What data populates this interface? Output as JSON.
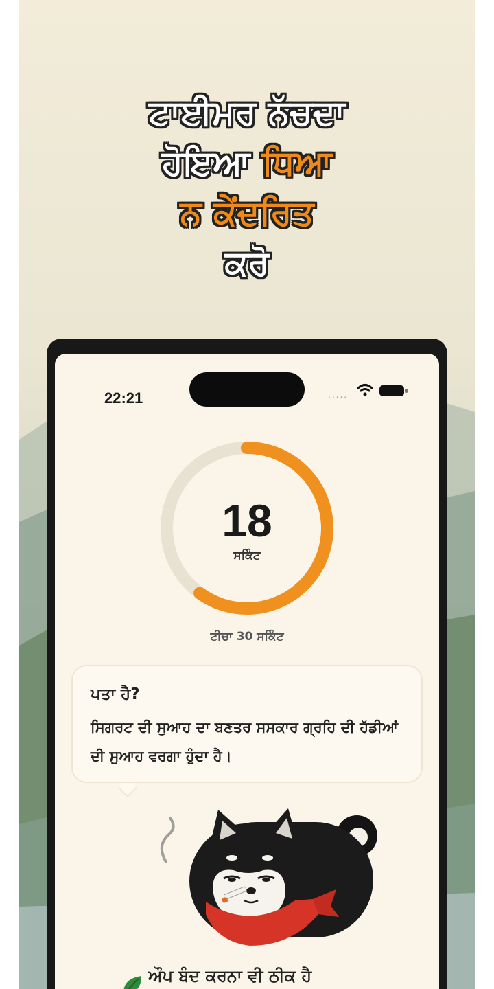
{
  "promo": {
    "headline_line1": "ਟਾਈਮਰ ਨੱਚਦਾ",
    "headline_line2_plain": "ਹੋਇਆ ",
    "headline_line2_accent": "ਧਿਆ",
    "headline_line3_accent": "ਨ ਕੇਂਦਰਿਤ",
    "headline_line4": "ਕਰੋ",
    "accent_color": "#ee8a1a"
  },
  "status_bar": {
    "time": "22:21",
    "signal_dots": ".....",
    "icons": [
      "wifi-icon",
      "battery-icon"
    ]
  },
  "timer": {
    "value": "18",
    "unit": "ਸਕਿੰਟ",
    "target": "ਟੀਚਾ 30 ਸਕਿੰਟ",
    "progress_fraction": 0.6,
    "progress_color": "#f0901e",
    "track_color": "#e8e2d2"
  },
  "fact": {
    "title": "ਪਤਾ ਹੈ?",
    "body": "ਸਿਗਰਟ ਦੀ ਸੁਆਹ ਦਾ ਬਣਤਰ ਸਸਕਾਰ ਗ੍ਰਹਿ ਦੀ ਹੱਡੀਆਂ ਦੀ ਸੁਆਹ ਵਰਗਾ ਹੁੰਦਾ ਹੈ।"
  },
  "mascot": {
    "icon": "smoking-dog-icon"
  },
  "bottom": {
    "text": "ਔਪ ਬੰਦ ਕਰਨਾ ਵੀ ਠੀਕ ਹੈ",
    "icon": "leaf-icon"
  }
}
